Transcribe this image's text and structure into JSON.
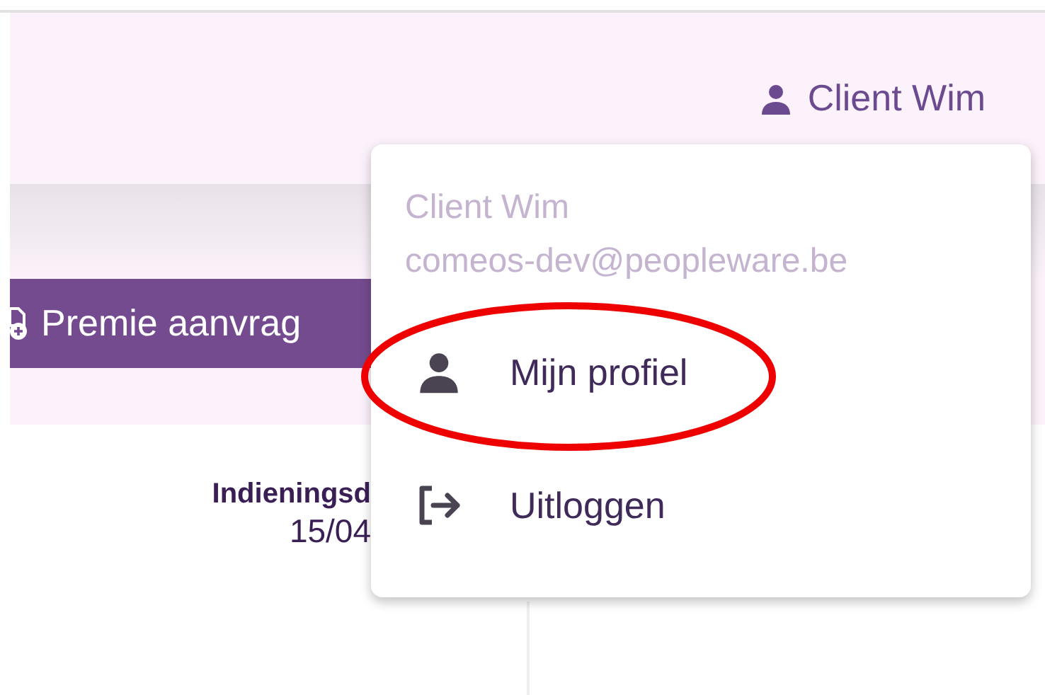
{
  "header": {
    "user_name": "Client Wim"
  },
  "toolbar": {
    "button_label": "Premie aanvrag"
  },
  "table": {
    "column_header": "Indieningsd",
    "cell": "15/04"
  },
  "user_menu": {
    "name": "Client Wim",
    "email": "comeos-dev@peopleware.be",
    "items": [
      {
        "label": "Mijn profiel",
        "kind": "profile",
        "circled": true
      },
      {
        "label": "Uitloggen",
        "kind": "logout",
        "circled": false
      }
    ]
  }
}
